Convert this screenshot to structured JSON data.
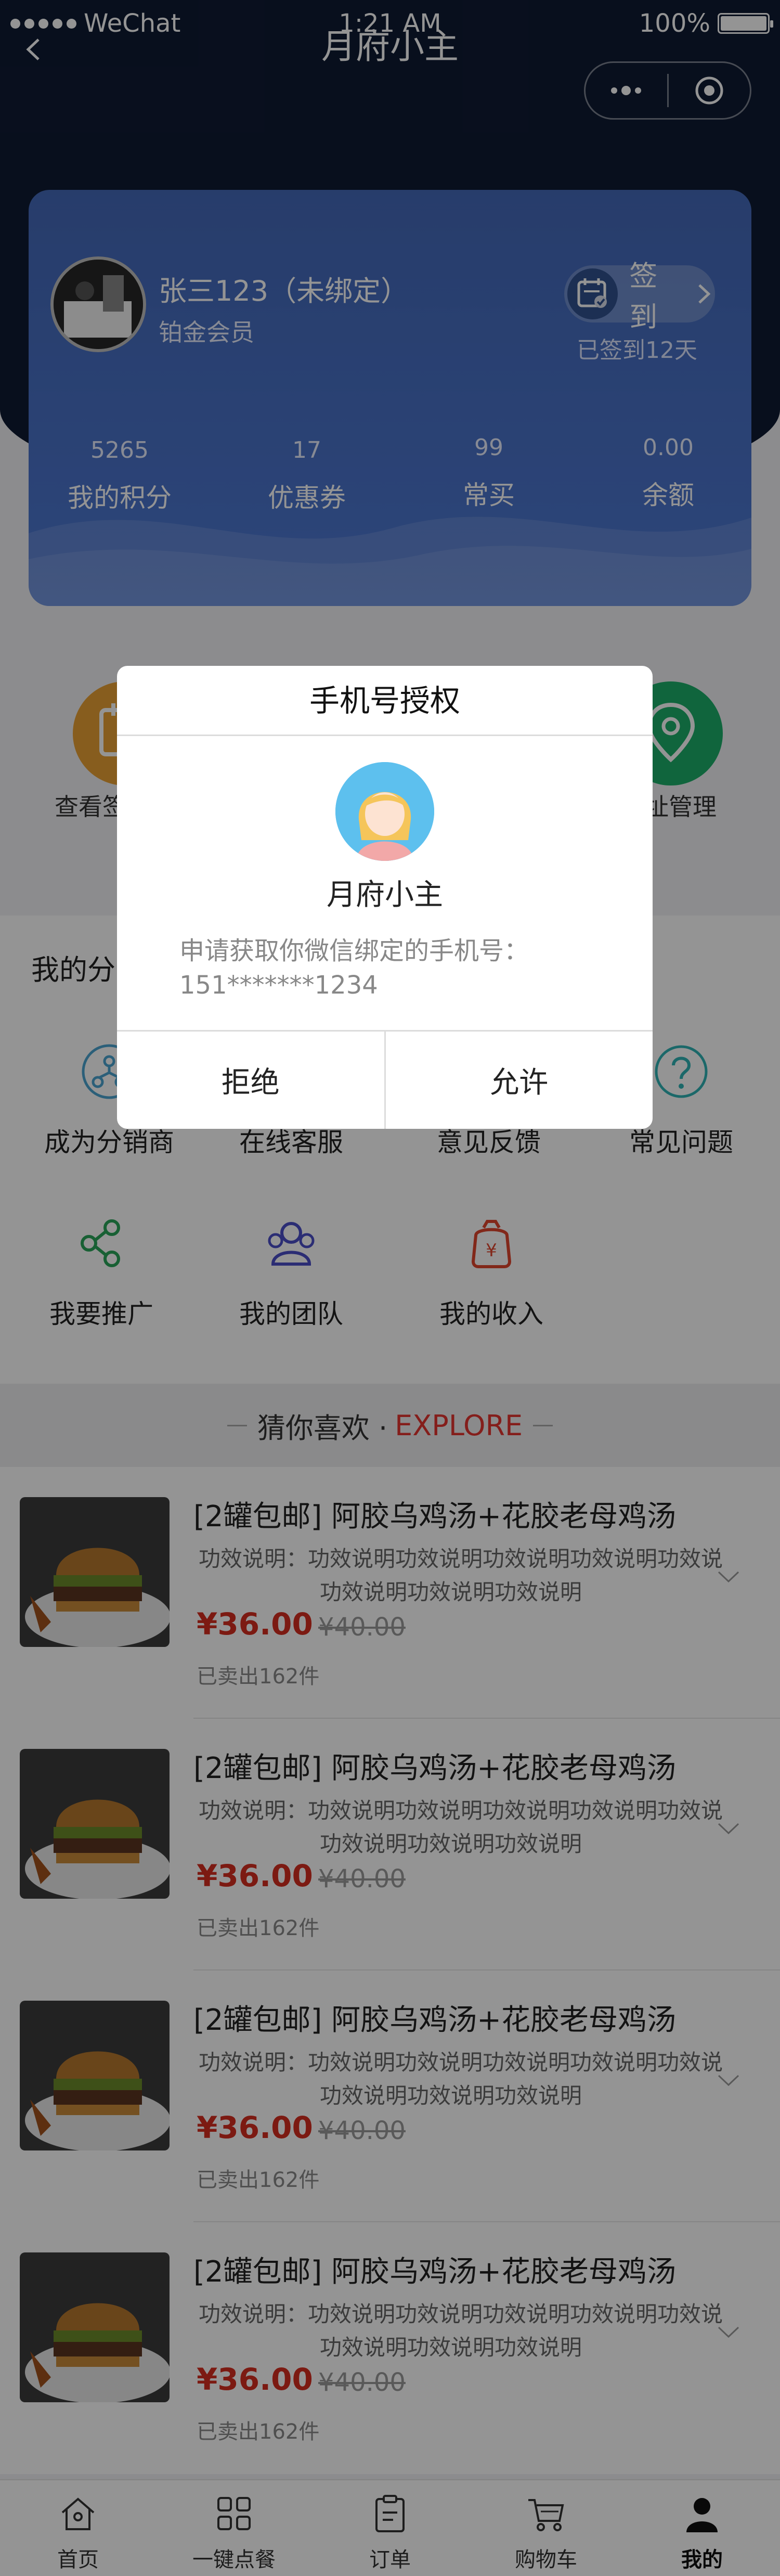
{
  "status_bar": {
    "carrier": "WeChat",
    "time": "1:21 AM",
    "battery": "100%"
  },
  "nav": {
    "title": "月府小主"
  },
  "profile": {
    "name": "张三123（未绑定）",
    "level": "铂金会员",
    "sign_label": "签到",
    "signed_days": "已签到12天"
  },
  "stats": [
    {
      "value": "5265",
      "label": "我的积分"
    },
    {
      "value": "17",
      "label": "优惠券"
    },
    {
      "value": "99",
      "label": "常买"
    },
    {
      "value": "0.00",
      "label": "余额"
    }
  ],
  "quick_actions": {
    "left_label": "查看签",
    "right_label": "址管理"
  },
  "distribution": {
    "title": "我的分",
    "tools": [
      {
        "label": "成为分销商",
        "icon": "network-icon"
      },
      {
        "label": "在线客服",
        "icon": "headset-icon"
      },
      {
        "label": "意见反馈",
        "icon": "feedback-icon"
      },
      {
        "label": "常见问题",
        "icon": "question-icon"
      },
      {
        "label": "我要推广",
        "icon": "share-icon"
      },
      {
        "label": "我的团队",
        "icon": "team-icon"
      },
      {
        "label": "我的收入",
        "icon": "income-icon"
      }
    ]
  },
  "explore": {
    "title": "猜你喜欢 ·",
    "en": "EXPLORE"
  },
  "products": [
    {
      "title": "[2罐包邮] 阿胶乌鸡汤+花胶老母鸡汤",
      "desc_line1": "功效说明：功效说明功效说明功效说明功效说明功效说",
      "desc_line2": "功效说明功效说明功效说明",
      "price": "¥36.00",
      "original_price": "¥40.00",
      "sold": "已卖出162件"
    },
    {
      "title": "[2罐包邮] 阿胶乌鸡汤+花胶老母鸡汤",
      "desc_line1": "功效说明：功效说明功效说明功效说明功效说明功效说",
      "desc_line2": "功效说明功效说明功效说明",
      "price": "¥36.00",
      "original_price": "¥40.00",
      "sold": "已卖出162件"
    },
    {
      "title": "[2罐包邮] 阿胶乌鸡汤+花胶老母鸡汤",
      "desc_line1": "功效说明：功效说明功效说明功效说明功效说明功效说",
      "desc_line2": "功效说明功效说明功效说明",
      "price": "¥36.00",
      "original_price": "¥40.00",
      "sold": "已卖出162件"
    },
    {
      "title": "[2罐包邮] 阿胶乌鸡汤+花胶老母鸡汤",
      "desc_line1": "功效说明：功效说明功效说明功效说明功效说明功效说",
      "desc_line2": "功效说明功效说明功效说明",
      "price": "¥36.00",
      "original_price": "¥40.00",
      "sold": "已卖出162件"
    }
  ],
  "tabbar": [
    {
      "label": "首页",
      "icon": "home-icon"
    },
    {
      "label": "一键点餐",
      "icon": "grid-icon"
    },
    {
      "label": "订单",
      "icon": "order-icon"
    },
    {
      "label": "购物车",
      "icon": "cart-icon"
    },
    {
      "label": "我的",
      "icon": "user-icon",
      "active": true
    }
  ],
  "modal": {
    "title": "手机号授权",
    "app_name": "月府小主",
    "desc": "申请获取你微信绑定的手机号：",
    "phone": "151*******1234",
    "reject": "拒绝",
    "allow": "允许"
  },
  "colors": {
    "nav_bg": "#0f1a33",
    "card": "#4a72c8",
    "price": "#d62d1f",
    "explore_accent": "#e3342f"
  }
}
